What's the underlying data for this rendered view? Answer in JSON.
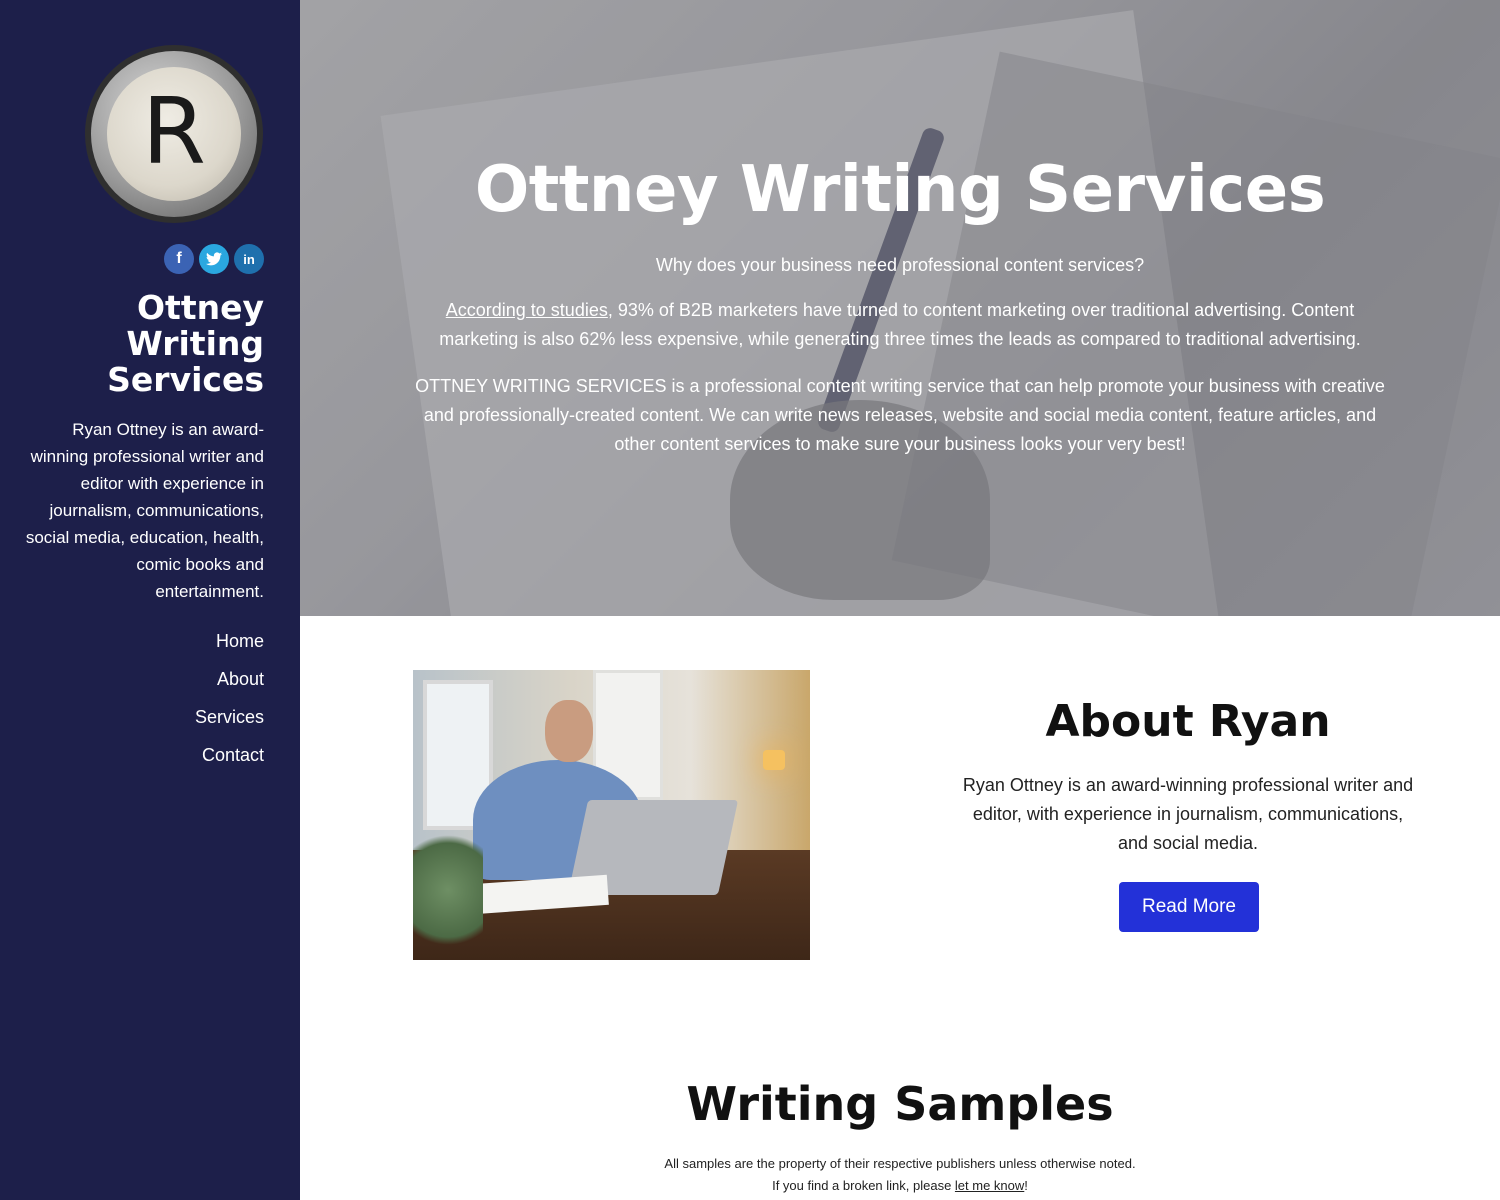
{
  "sidebar": {
    "logo_letter": "R",
    "social": [
      {
        "icon": "facebook-icon",
        "glyph": "f",
        "color": "#3b63b4"
      },
      {
        "icon": "twitter-icon",
        "glyph": "t",
        "color": "#2aa7e0"
      },
      {
        "icon": "linkedin-icon",
        "glyph": "in",
        "color": "#1f70ad"
      }
    ],
    "title_line1": "Ottney",
    "title_line2": "Writing",
    "title_line3": "Services",
    "description": "Ryan Ottney is an award-winning professional writer and editor with experience in journalism, communications, social media, education, health, comic books and entertainment.",
    "nav": [
      {
        "label": "Home"
      },
      {
        "label": "About"
      },
      {
        "label": "Services"
      },
      {
        "label": "Contact"
      }
    ],
    "background_color": "#1d1f4a"
  },
  "hero": {
    "title": "Ottney Writing Services",
    "subtitle": "Why does your business need professional content services?",
    "p1_link": "According to studies",
    "p1_rest": ", 93% of B2B marketers have turned to content marketing over traditional advertising. Content marketing is also 62% less expensive, while generating three times the leads as compared to traditional advertising.",
    "p2": "OTTNEY WRITING SERVICES is a professional content writing service that can help promote your business with creative and professionally-created content. We can write news releases, website and social media content, feature articles, and other content services to make sure your business looks your very best!"
  },
  "about": {
    "title": "About Ryan",
    "text": "Ryan Ottney is an award-winning professional writer and editor, with experience in journalism, communications, and social media.",
    "button_label": "Read More",
    "button_color": "#2331d8"
  },
  "samples": {
    "title": "Writing Samples",
    "note1": "All samples are the property of their respective publishers unless otherwise noted.",
    "note2_before": "If you find a broken link, please ",
    "note2_link": "let me know",
    "note2_after": "!"
  }
}
